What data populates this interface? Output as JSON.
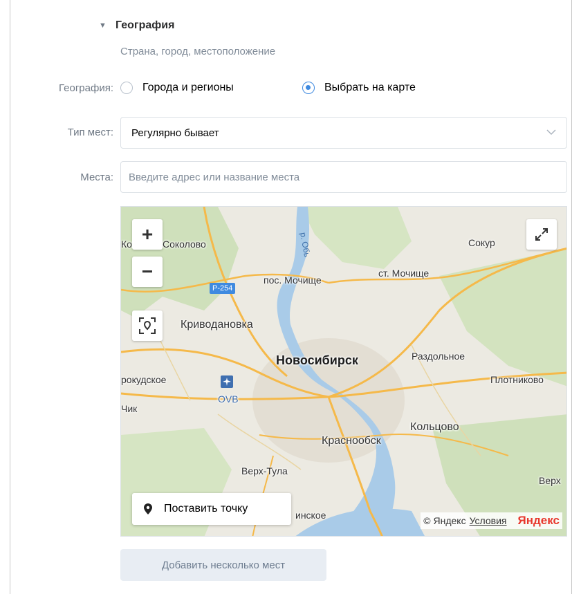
{
  "section": {
    "caret": "▼",
    "title": "География",
    "subtitle": "Страна, город, местоположение"
  },
  "geography": {
    "label": "География:",
    "options": [
      {
        "label": "Города и регионы",
        "checked": false
      },
      {
        "label": "Выбрать на карте",
        "checked": true
      }
    ]
  },
  "place_type": {
    "label": "Тип мест:",
    "value": "Регулярно бывает"
  },
  "places": {
    "label": "Места:",
    "placeholder": "Введите адрес или название места"
  },
  "map": {
    "zoom_in": "+",
    "zoom_out": "−",
    "labels": {
      "sokolovo": "Соколово",
      "sokolovo_prefix": "Ко",
      "sokur": "Сокур",
      "pos_mochishche": "пос. Мочище",
      "st_mochishche": "ст. Мочище",
      "krivodanovka": "Криводановка",
      "novosibirsk": "Новосибирск",
      "razdolnoe": "Раздольное",
      "plotnikovo": "Плотниково",
      "kudskoe": "рокудское",
      "chik": "Чик",
      "ovb": "OVB",
      "koltsovo": "Кольцово",
      "krasnoobsk": "Краснообск",
      "verkh_tula": "Верх-Тула",
      "verkh": "Верх",
      "inskoe": "инское",
      "river": "р. Обь"
    },
    "road_badge": "Р-254",
    "set_point": "Поставить точку",
    "copyright": "© Яндекс",
    "terms": "Условия",
    "brand": "Яндекс"
  },
  "add_button": "Добавить несколько мест",
  "colors": {
    "accent": "#3f8ae0",
    "map_bg": "#eceae2",
    "water": "#a9cbe8",
    "road": "#f5b94a",
    "forest": "#cfe0bb",
    "brand": "#e8372c"
  }
}
